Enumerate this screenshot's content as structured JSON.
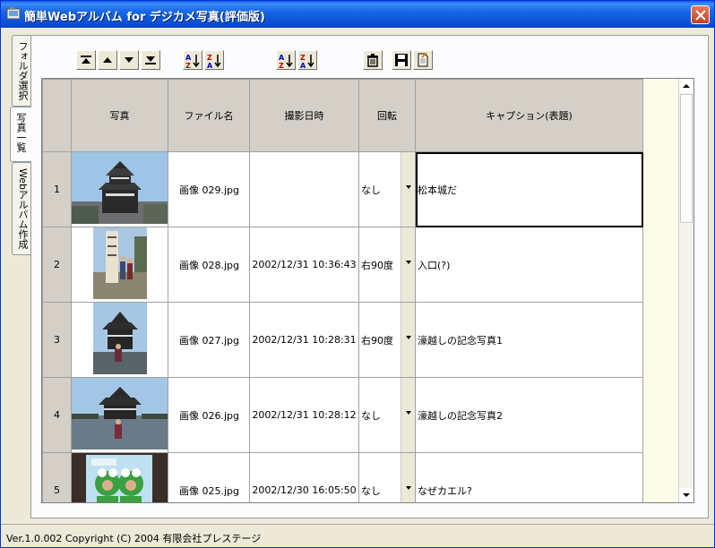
{
  "window": {
    "title": "簡単Webアルバム for デジカメ写真(評価版)"
  },
  "tabs": [
    {
      "label": "フォルダ選択"
    },
    {
      "label": "写真一覧"
    },
    {
      "label": "Webアルバム作成"
    }
  ],
  "table": {
    "columns": [
      "写真",
      "ファイル名",
      "撮影日時",
      "回転",
      "キャプション(表題)"
    ],
    "rows": [
      {
        "num": "1",
        "filename": "画像 029.jpg",
        "date": "",
        "rotation": "なし",
        "caption": "松本城だ"
      },
      {
        "num": "2",
        "filename": "画像 028.jpg",
        "date": "2002/12/31 10:36:43",
        "rotation": "右90度",
        "caption": "入口(?)"
      },
      {
        "num": "3",
        "filename": "画像 027.jpg",
        "date": "2002/12/31 10:28:31",
        "rotation": "右90度",
        "caption": "濠越しの記念写真1"
      },
      {
        "num": "4",
        "filename": "画像 026.jpg",
        "date": "2002/12/31 10:28:12",
        "rotation": "なし",
        "caption": "濠越しの記念写真2"
      },
      {
        "num": "5",
        "filename": "画像 025.jpg",
        "date": "2002/12/30 16:05:50",
        "rotation": "なし",
        "caption": "なぜカエル?"
      }
    ]
  },
  "status": {
    "text": "Ver.1.0.002 Copyright (C) 2004 有限会社プレステージ"
  },
  "colors": {
    "titlebar": "#0a5ee6",
    "panel": "#fcfcfe",
    "grid_bg": "#fbfbe8"
  }
}
